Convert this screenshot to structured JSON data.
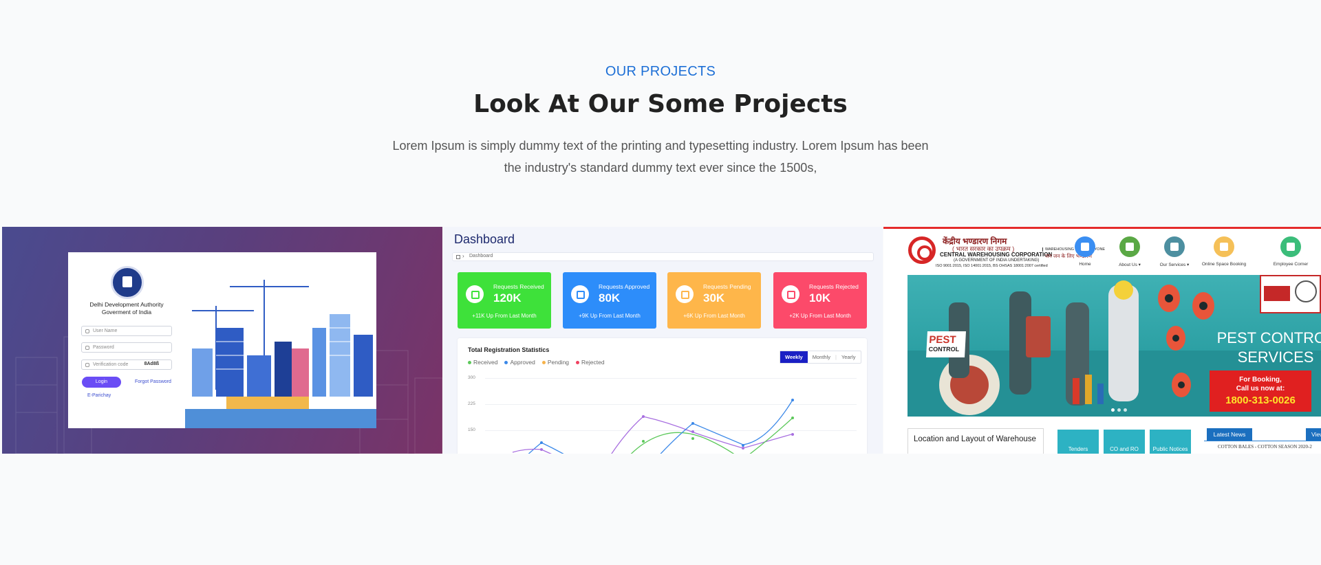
{
  "section": {
    "eyebrow": "OUR PROJECTS",
    "title": "Look At Our Some Projects",
    "description": "Lorem Ipsum is simply dummy text of the printing and typesetting industry. Lorem Ipsum has been the industry's standard dummy text ever since the 1500s,"
  },
  "projects": {
    "dda": {
      "org_line1": "Delhi Development Authority",
      "org_line2": "Goverment of India",
      "username_placeholder": "User Name",
      "password_placeholder": "Password",
      "verification_placeholder": "Verification code",
      "captcha": "8Ad8ß",
      "login_label": "Login",
      "forgot_label": "Forgot Password",
      "eparichay_label": "E-Parichay",
      "accent": "#6a4df5"
    },
    "dashboard": {
      "title": "Dashboard",
      "breadcrumb": "Dashboard",
      "stats": [
        {
          "label": "Requests Received",
          "value": "120K",
          "sub": "+11K Up From Last Month",
          "color": "#3ee13a"
        },
        {
          "label": "Requests Approved",
          "value": "80K",
          "sub": "+9K Up From Last Month",
          "color": "#2d8dfa"
        },
        {
          "label": "Requests Pending",
          "value": "30K",
          "sub": "+6K Up From Last Month",
          "color": "#feb64a"
        },
        {
          "label": "Requests Rejected",
          "value": "10K",
          "sub": "+2K Up From Last Month",
          "color": "#fc4a6a"
        }
      ],
      "chart": {
        "title": "Total Registration Statistics",
        "periods": [
          "Weekly",
          "Monthly",
          "Yearly"
        ],
        "active_period": "Weekly",
        "y_ticks": [
          "300",
          "225",
          "150"
        ]
      }
    },
    "cwc": {
      "hindi_name": "केंद्रीय भण्डारण निगम",
      "hindi_sub": "( भारत सरकार का उपक्रम )",
      "name": "CENTRAL WAREHOUSING CORPORATION",
      "sub": "(A GOVERNMENT OF INDIA UNDERTAKING)",
      "iso": "ISO 9001:2015, ISO 14001:2015, BS OHSAS 18001:2007 certified",
      "tagline_en": "WAREHOUSING FOR EVERYONE",
      "tagline_hi": "जन जन के लिए भण्डारण",
      "nav": [
        {
          "label": "Home",
          "color": "#3a8ef2",
          "icon": "home-icon"
        },
        {
          "label": "About Us ▾",
          "color": "#5aa845",
          "icon": "info-icon"
        },
        {
          "label": "Our Services ▾",
          "color": "#4d8fa0",
          "icon": "tools-icon"
        },
        {
          "label": "Online Space Booking",
          "color": "#f5c058",
          "icon": "booking-icon"
        },
        {
          "label": "Employee Corner",
          "color": "#3bbd7a",
          "icon": "people-icon"
        }
      ],
      "banner": {
        "pest_badge_1": "PEST",
        "pest_badge_2": "CONTROL",
        "services_line1": "PEST CONTROL",
        "services_line2": "SERVICES",
        "booking_line1": "For Booking,",
        "booking_line2": "Call us now at:",
        "phone": "1800-313-0026"
      },
      "location_box": "Location and Layout of Warehouse",
      "tiles": [
        "Tenders",
        "CO and RO",
        "Public Notices"
      ],
      "news_tab": "Latest News",
      "view_tab": "View",
      "news_item": "COTTON BALES - COTTON SEASON 2020-2"
    }
  }
}
